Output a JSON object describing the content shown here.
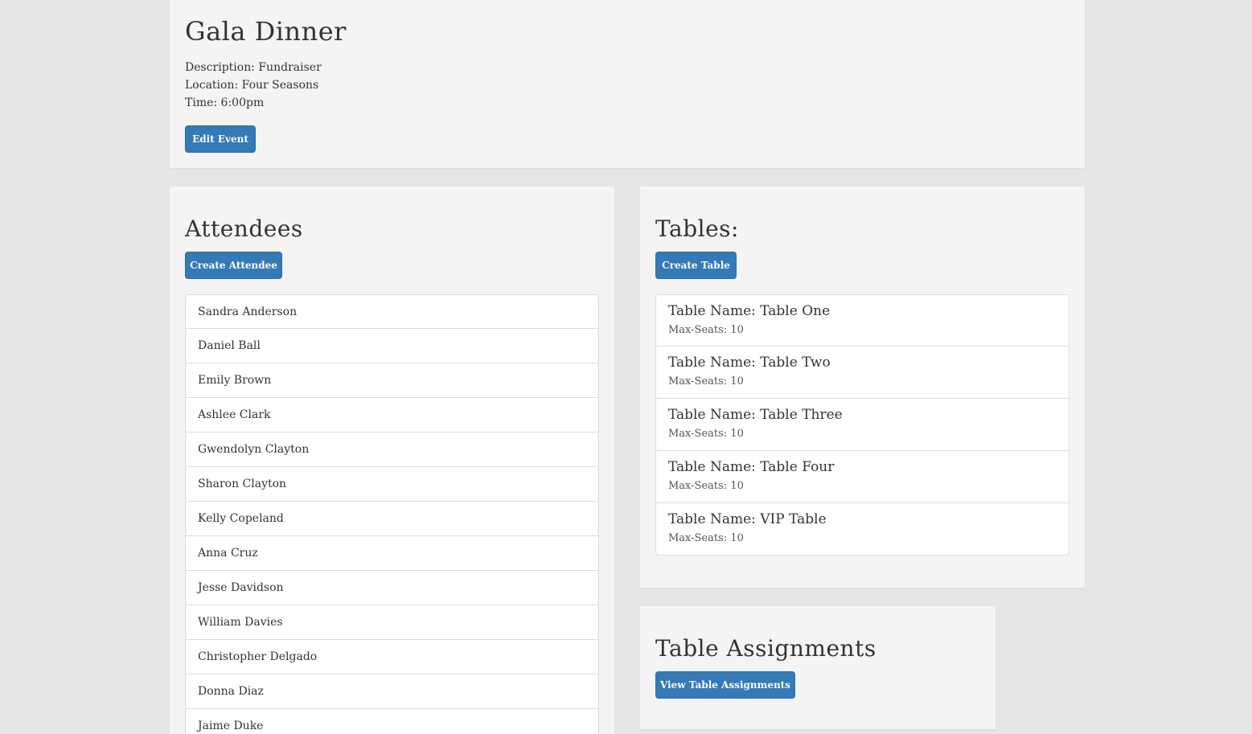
{
  "event": {
    "title": "Gala Dinner",
    "description_label": "Description:",
    "description": "Fundraiser",
    "location_label": "Location:",
    "location": "Four Seasons",
    "time_label": "Time:",
    "time": "6:00pm",
    "edit_button": "Edit Event"
  },
  "attendees": {
    "heading": "Attendees",
    "create_button": "Create Attendee",
    "items": [
      "Sandra Anderson",
      "Daniel Ball",
      "Emily Brown",
      "Ashlee Clark",
      "Gwendolyn Clayton",
      "Sharon Clayton",
      "Kelly Copeland",
      "Anna Cruz",
      "Jesse Davidson",
      "William Davies",
      "Christopher Delgado",
      "Donna Diaz",
      "Jaime Duke"
    ]
  },
  "tables": {
    "heading": "Tables:",
    "create_button": "Create Table",
    "name_label": "Table Name:",
    "seats_label": "Max-Seats:",
    "items": [
      {
        "name": "Table One",
        "max_seats": "10"
      },
      {
        "name": "Table Two",
        "max_seats": "10"
      },
      {
        "name": "Table Three",
        "max_seats": "10"
      },
      {
        "name": "Table Four",
        "max_seats": "10"
      },
      {
        "name": "VIP Table",
        "max_seats": "10"
      }
    ]
  },
  "assignments": {
    "heading": "Table Assignments",
    "view_button": "View Table Assignments"
  },
  "colors": {
    "primary_button": "#337ab7",
    "panel_background": "#f4f4f4",
    "page_background": "#e6e6e6"
  }
}
